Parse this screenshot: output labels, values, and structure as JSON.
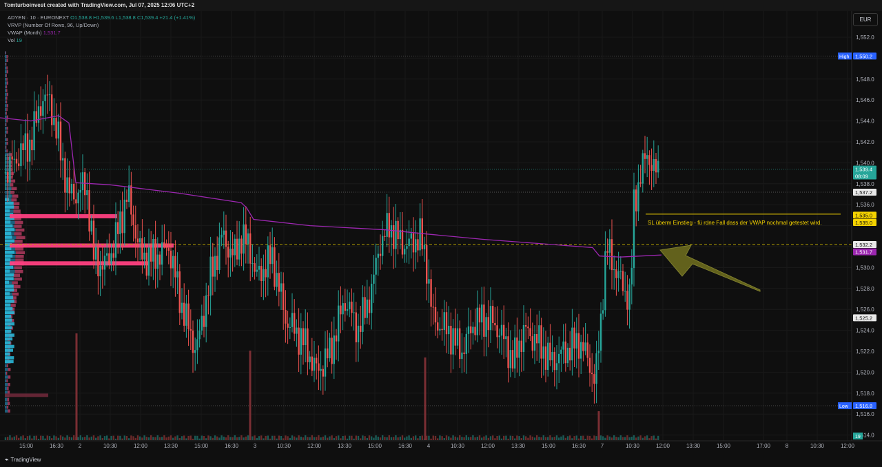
{
  "header": {
    "title": "Tomturboinvest created with TradingView.com, Jul 07, 2025 12:06 UTC+2"
  },
  "legend": {
    "symbol": "ADYEN · 10 · EURONEXT",
    "ohlc": [
      "O1,538.8",
      "H1,539.6",
      "L1,538.8",
      "C1,539.4",
      "+21.4 (+1.41%)"
    ],
    "vrvp": "VRVP (Number Of Rows, 96, Up/Down)",
    "vwap_label": "VWAP (Month)",
    "vwap_value": "1,531.7",
    "vol_label": "Vol",
    "vol_value": "19"
  },
  "currency_button": "EUR",
  "footer": {
    "logo": "TradingView"
  },
  "colors": {
    "up": "#26a69a",
    "down": "#ef5350",
    "vwap": "#9c27b0",
    "hvn": "#ff4081",
    "annotation": "#f5d300",
    "arrow": "#6b6a1e"
  },
  "annotation": {
    "text": "SL überm Einstieg - fü rdne Fall dass der VWAP nochmal getestet wird."
  },
  "chart_data": {
    "type": "candlestick",
    "title": "ADYEN · 10 · EURONEXT",
    "y_ticks": [
      1552,
      1550,
      1548,
      1546,
      1544,
      1542,
      1540,
      1538,
      1536,
      1534,
      1532,
      1530,
      1528,
      1526,
      1524,
      1522,
      1520,
      1518,
      1516,
      1514
    ],
    "y_tick_labels": [
      "1,552.0",
      "",
      "1,548.0",
      "1,546.0",
      "1,544.0",
      "1,542.0",
      "1,540.0",
      "1,538.0",
      "1,536.0",
      "",
      "",
      "1,530.0",
      "1,528.0",
      "1,526.0",
      "1,524.0",
      "1,522.0",
      "1,520.0",
      "1,518.0",
      "1,516.0",
      "1,514.0"
    ],
    "x_tick_labels": [
      "15:00",
      "16:30",
      "2",
      "10:30",
      "12:00",
      "13:30",
      "15:00",
      "16:30",
      "3",
      "10:30",
      "12:00",
      "13:30",
      "15:00",
      "16:30",
      "4",
      "10:30",
      "12:00",
      "13:30",
      "15:00",
      "16:30",
      "7",
      "10:30",
      "12:00",
      "13:30",
      "15:00",
      "17:00",
      "8",
      "10:30",
      "12:00"
    ],
    "price_badges": [
      {
        "label": "High",
        "value": "1,550.2",
        "price": 1550.2,
        "bg": "#2962ff",
        "fg": "#ffffff"
      },
      {
        "label": "",
        "value": "1,539.4",
        "sub": "08:09",
        "price": 1539.4,
        "bg": "#26a69a",
        "fg": "#ffffff"
      },
      {
        "label": "",
        "value": "1,537.2",
        "price": 1537.2,
        "bg": "#e8e8e8",
        "fg": "#111111"
      },
      {
        "label": "",
        "value": "1,535.0",
        "price": 1535.0,
        "bg": "#f5d300",
        "fg": "#111111"
      },
      {
        "label": "",
        "value": "1,535.0",
        "price": 1534.3,
        "bg": "#f5d300",
        "fg": "#111111"
      },
      {
        "label": "",
        "value": "1,532.2",
        "price": 1532.2,
        "bg": "#e8e8e8",
        "fg": "#111111"
      },
      {
        "label": "",
        "value": "1,531.7",
        "price": 1531.5,
        "bg": "#9c27b0",
        "fg": "#ffffff"
      },
      {
        "label": "",
        "value": "1,525.2",
        "price": 1525.2,
        "bg": "#e8e8e8",
        "fg": "#111111"
      },
      {
        "label": "Low",
        "value": "1,516.8",
        "price": 1516.8,
        "bg": "#2962ff",
        "fg": "#ffffff"
      }
    ],
    "horizontal_lines": {
      "high": 1550.2,
      "low": 1516.8,
      "last": 1539.4,
      "sl": 1532.2,
      "dotted": 1537.2
    },
    "vwap": [
      [
        0,
        1544.3
      ],
      [
        45,
        1544.0
      ],
      [
        85,
        1544.5
      ],
      [
        100,
        1543.8
      ],
      [
        110,
        1538.1
      ],
      [
        160,
        1537.9
      ],
      [
        260,
        1537.1
      ],
      [
        350,
        1536.2
      ],
      [
        358,
        1535.7
      ],
      [
        368,
        1534.6
      ],
      [
        450,
        1534.0
      ],
      [
        560,
        1533.6
      ],
      [
        620,
        1533.2
      ],
      [
        700,
        1532.7
      ],
      [
        780,
        1532.3
      ],
      [
        860,
        1531.9
      ],
      [
        870,
        1531.1
      ],
      [
        900,
        1531.0
      ],
      [
        960,
        1531.2
      ]
    ],
    "hvn_bars": [
      {
        "price": 1534.9,
        "x_end": 170
      },
      {
        "price": 1532.1,
        "x_end": 252
      },
      {
        "price": 1530.4,
        "x_end": 216
      }
    ]
  }
}
